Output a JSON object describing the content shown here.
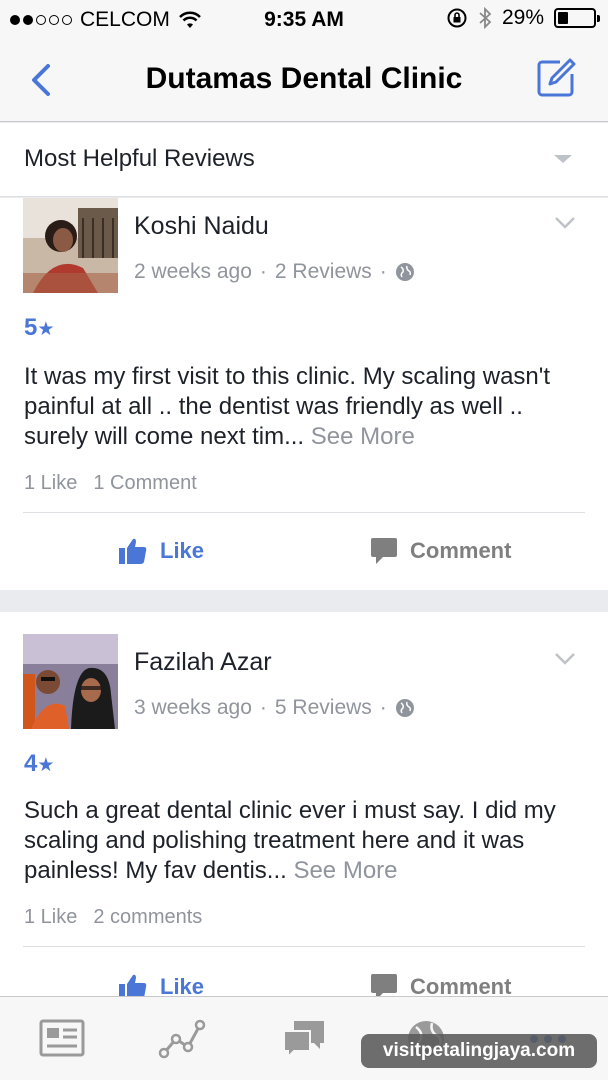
{
  "status_bar": {
    "carrier": "CELCOM",
    "time": "9:35 AM",
    "battery": "29%",
    "battery_level": 0.29
  },
  "nav": {
    "title": "Dutamas Dental Clinic",
    "back_icon": "chevron-left-icon",
    "edit_icon": "compose-icon"
  },
  "sort": {
    "label": "Most Helpful Reviews"
  },
  "reviews": [
    {
      "name": "Koshi Naidu",
      "time": "2 weeks ago",
      "review_count": "2 Reviews",
      "rating": "5",
      "text": "It was my first visit to this clinic. My scaling wasn't painful at all .. the dentist was friendly as well .. surely will come next tim...",
      "see_more": "See More",
      "likes": "1 Like",
      "comments": "1 Comment",
      "like_label": "Like",
      "comment_label": "Comment"
    },
    {
      "name": "Fazilah Azar",
      "time": "3 weeks ago",
      "review_count": "5 Reviews",
      "rating": "4",
      "text": "Such a great dental clinic ever i must say. I did my scaling and polishing treatment here and it was painless! My fav dentis...",
      "see_more": "See More",
      "likes": "1 Like",
      "comments": "2 comments",
      "like_label": "Like",
      "comment_label": "Comment"
    }
  ],
  "tabs": [
    "news-feed-icon",
    "insights-icon",
    "messages-icon",
    "globe-icon",
    "more-icon"
  ],
  "watermark": "visitpetalingjaya.com",
  "colors": {
    "accent": "#4a76d8",
    "muted": "#90949c",
    "background": "#e9ebee"
  }
}
